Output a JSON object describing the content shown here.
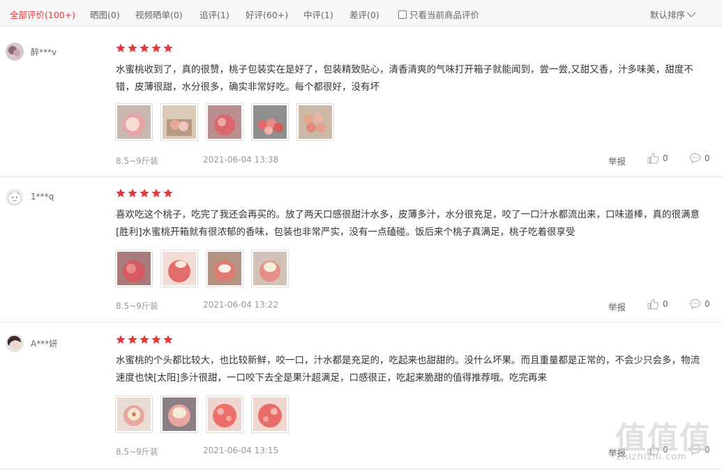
{
  "filter_bar": {
    "tabs": [
      {
        "label": "全部评价(100+)",
        "active": true
      },
      {
        "label": "晒图(0)"
      },
      {
        "label": "视频晒单(0)"
      },
      {
        "label": "追评(1)"
      },
      {
        "label": "好评(60+)"
      },
      {
        "label": "中评(1)"
      },
      {
        "label": "差评(0)"
      }
    ],
    "only_current_label": "只看当前商品评价",
    "sort_label": "默认排序"
  },
  "colors": {
    "accent": "#e4393c",
    "star": "#e4393c",
    "muted": "#999999"
  },
  "reviews": [
    {
      "username": "醉***v",
      "avatar_icon": "user-avatar-icon",
      "stars": 5,
      "text": "水蜜桃收到了，真的很赞，桃子包装实在是好了，包装精致贴心，清香清爽的气味打开箱子就能闻到，尝一尝,又甜又香，汁多味美，甜度不错，皮薄很甜，水分很多，确实非常好吃。每个都很好，没有坏",
      "spec": "8.5~9斤装",
      "date": "2021-06-04 13:38",
      "report_label": "举报",
      "likes": "0",
      "replies": "0"
    },
    {
      "username": "1***q",
      "avatar_icon": "default-avatar-icon",
      "stars": 5,
      "text": "喜欢吃这个桃子，吃完了我还会再买的。放了两天口感很甜汁水多，皮薄多汁，水分很充足，咬了一口汁水都流出来，口味道棒，真的很满意[胜利]水蜜桃开箱就有很浓郁的香味，包装也非常严实，没有一点磕碰。饭后来个桃子真满足，桃子吃着很享受",
      "spec": "8.5~9斤装",
      "date": "2021-06-04 13:22",
      "report_label": "举报",
      "likes": "0",
      "replies": "0"
    },
    {
      "username": "A***妍",
      "avatar_icon": "user-avatar-icon",
      "stars": 5,
      "text": "水蜜桃的个头都比较大，也比较新鲜，咬一口，汁水都是充足的，吃起来也甜甜的。没什么坏果。而且重量都是正常的，不会少只会多，物流速度也快[太阳]多汁很甜，一口咬下去全是果汁超满足，口感很正，吃起来脆甜的值得推荐哦。吃完再来",
      "spec": "8.5~9斤装",
      "date": "2021-06-04 13:15",
      "report_label": "举报",
      "likes": "0",
      "replies": "0"
    }
  ],
  "watermark": {
    "logo": "值值值",
    "url": "zhizhizhi.com"
  }
}
